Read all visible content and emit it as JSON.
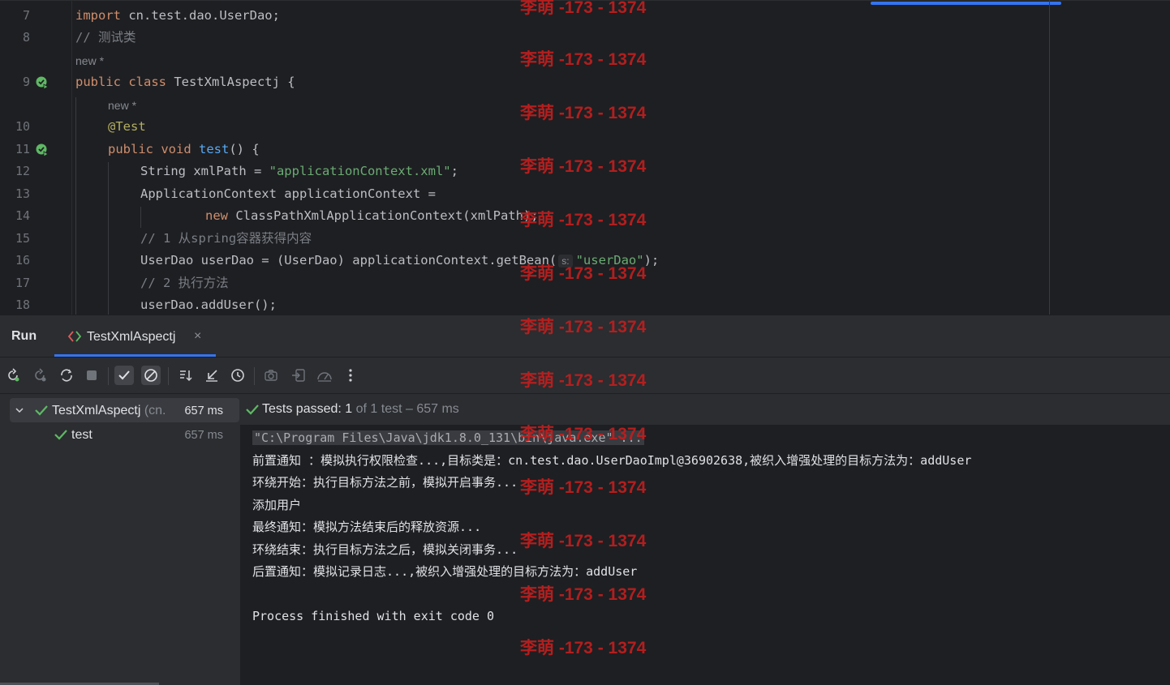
{
  "editor": {
    "lines": [
      {
        "num": "7",
        "html_id": "l7"
      },
      {
        "num": "8",
        "html_id": "l8"
      },
      {
        "num": "9",
        "html_id": "l9"
      },
      {
        "num": "10",
        "html_id": "l10"
      },
      {
        "num": "11",
        "html_id": "l11"
      },
      {
        "num": "12",
        "html_id": "l12"
      },
      {
        "num": "13",
        "html_id": "l13"
      },
      {
        "num": "14",
        "html_id": "l14"
      },
      {
        "num": "15",
        "html_id": "l15"
      },
      {
        "num": "16",
        "html_id": "l16"
      },
      {
        "num": "17",
        "html_id": "l17"
      },
      {
        "num": "18",
        "html_id": "l18"
      }
    ],
    "code": {
      "l7_kw": "import",
      "l7_rest": " cn.test.dao.UserDao;",
      "l8": "// 测试类",
      "hint_class": "new *",
      "l9_kw": "public class",
      "l9_rest": " TestXmlAspectj {",
      "hint_method": "new *",
      "l10": "@Test",
      "l11_kw": "public void",
      "l11_fn": "test",
      "l11_rest": "() {",
      "l12_a": "String xmlPath = ",
      "l12_str": "\"applicationContext.xml\"",
      "l12_b": ";",
      "l13": "ApplicationContext applicationContext =",
      "l14_kw": "new",
      "l14_rest": " ClassPathXmlApplicationContext(xmlPath);",
      "l15": "// 1 从spring容器获得内容",
      "l16_a": "UserDao userDao = (UserDao) applicationContext.getBean(",
      "l16_inlay": "s:",
      "l16_str": "\"userDao\"",
      "l16_b": ");",
      "l17": "// 2 执行方法",
      "l18": "userDao.addUser();"
    }
  },
  "run": {
    "title": "Run",
    "tab_label": "TestXmlAspectj",
    "tab_close": "×",
    "tree": {
      "root_label": "TestXmlAspectj",
      "root_pkg": "(cn.",
      "root_time": "657 ms",
      "child_label": "test",
      "child_time": "657 ms"
    },
    "status": {
      "passed": "Tests passed: 1",
      "rest": " of 1 test – 657 ms"
    },
    "console": {
      "cmd": "\"C:\\Program Files\\Java\\jdk1.8.0_131\\bin\\java.exe\" ...",
      "lines": [
        "前置通知 ：模拟执行权限检查...,目标类是：cn.test.dao.UserDaoImpl@36902638,被织入增强处理的目标方法为：addUser",
        "环绕开始：执行目标方法之前，模拟开启事务...",
        "添加用户",
        "最终通知：模拟方法结束后的释放资源...",
        "环绕结束：执行目标方法之后，模拟关闭事务...",
        "后置通知：模拟记录日志...,被织入增强处理的目标方法为：addUser"
      ],
      "exit": "Process finished with exit code 0"
    }
  },
  "watermark": "李萌 -173 - 1374",
  "colors": {
    "accent": "#3574f0",
    "pass_green": "#5fb865",
    "watermark_red": "#c01e1e"
  }
}
